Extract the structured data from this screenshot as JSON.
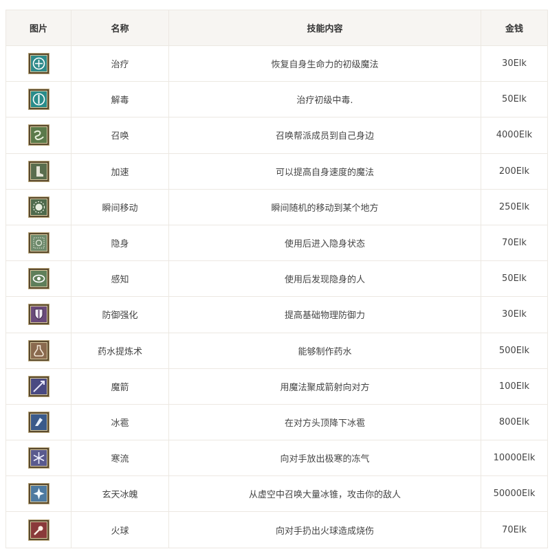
{
  "headers": {
    "image": "图片",
    "name": "名称",
    "content": "技能内容",
    "price": "金钱"
  },
  "rows": [
    {
      "icon": "heal-icon",
      "color": "#2f8a8a",
      "name": "治疗",
      "content": "恢复自身生命力的初级魔法",
      "price": "30Elk"
    },
    {
      "icon": "cure-poison-icon",
      "color": "#2a8c8a",
      "name": "解毒",
      "content": "治疗初级中毒.",
      "price": "50Elk"
    },
    {
      "icon": "summon-icon",
      "color": "#5b7a4a",
      "name": "召唤",
      "content": "召唤帮派成员到自己身边",
      "price": "4000Elk"
    },
    {
      "icon": "haste-boot-icon",
      "color": "#5a6e4e",
      "name": "加速",
      "content": "可以提高自身速度的魔法",
      "price": "200Elk"
    },
    {
      "icon": "teleport-icon",
      "color": "#4e6a4c",
      "name": "瞬间移动",
      "content": "瞬间随机的移动到某个地方",
      "price": "250Elk"
    },
    {
      "icon": "invisibility-icon",
      "color": "#6e8a6c",
      "name": "隐身",
      "content": "使用后进入隐身状态",
      "price": "70Elk"
    },
    {
      "icon": "eye-icon",
      "color": "#5f7f5a",
      "name": "感知",
      "content": "使用后发现隐身的人",
      "price": "50Elk"
    },
    {
      "icon": "shield-icon",
      "color": "#6a4a7a",
      "name": "防御强化",
      "content": "提高基础物理防御力",
      "price": "30Elk"
    },
    {
      "icon": "potion-flask-icon",
      "color": "#8a6a4e",
      "name": "药水提炼术",
      "content": "能够制作药水",
      "price": "500Elk"
    },
    {
      "icon": "magic-arrow-icon",
      "color": "#4a4a82",
      "name": "魔箭",
      "content": "用魔法聚成箭射向对方",
      "price": "100Elk"
    },
    {
      "icon": "hail-icon",
      "color": "#3a5a8a",
      "name": "冰雹",
      "content": "在对方头顶降下冰雹",
      "price": "800Elk"
    },
    {
      "icon": "snowflake-icon",
      "color": "#5a5a8e",
      "name": "寒流",
      "content": "向对手放出极寒的冻气",
      "price": "10000Elk"
    },
    {
      "icon": "ice-burst-icon",
      "color": "#4e7aa0",
      "name": "玄天冰魄",
      "content": "从虚空中召唤大量冰锥，攻击你的敌人",
      "price": "50000Elk"
    },
    {
      "icon": "fireball-icon",
      "color": "#8a3a3a",
      "name": "火球",
      "content": "向对手扔出火球造成烧伤",
      "price": "70Elk"
    }
  ]
}
